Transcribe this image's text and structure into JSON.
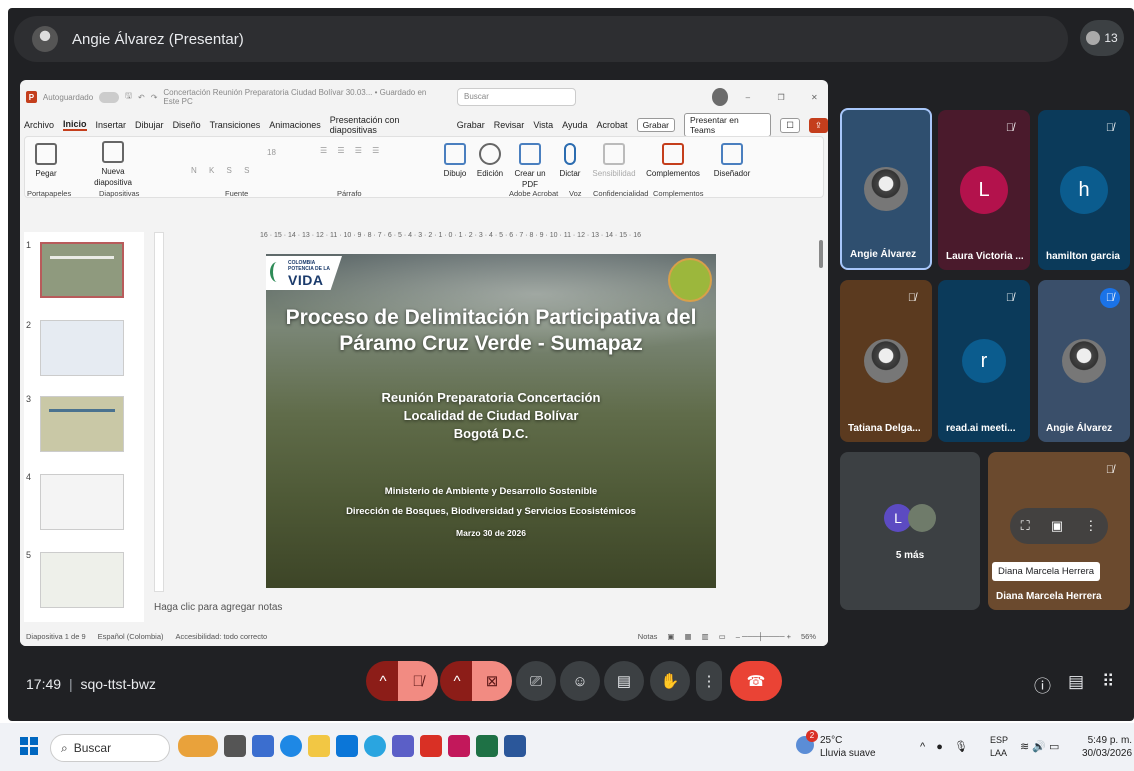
{
  "meet": {
    "presenter_label": "Angie Álvarez (Presentar)",
    "participant_count": "13",
    "time": "17:49",
    "separator": "|",
    "meeting_code": "sqo-ttst-bwz"
  },
  "ppt": {
    "autosave": "Autoguardado",
    "filename": "Concertación Reunión Preparatoria Ciudad Bolívar 30.03... • Guardado en Este PC",
    "search_placeholder": "Buscar",
    "menu": [
      "Archivo",
      "Inicio",
      "Insertar",
      "Dibujar",
      "Diseño",
      "Transiciones",
      "Animaciones",
      "Presentación con diapositivas",
      "Grabar",
      "Revisar",
      "Vista",
      "Ayuda",
      "Acrobat"
    ],
    "record_btn": "Grabar",
    "teams_btn": "Presentar en Teams",
    "ribbon": {
      "paste": "Pegar",
      "new_slide": "Nueva diapositiva",
      "draw": "Dibujo",
      "edit": "Edición",
      "create_pdf": "Crear un PDF",
      "dictate": "Dictar",
      "sensitivity": "Sensibilidad",
      "addins": "Complementos",
      "designer": "Diseñador",
      "font_size": "18",
      "groups": [
        "Portapapeles",
        "Diapositivas",
        "Fuente",
        "Párrafo",
        "Adobe Acrobat",
        "Voz",
        "Confidencialidad",
        "Complementos"
      ]
    },
    "ruler": "16 · 15 · 14 · 13 · 12 · 11 · 10 · 9 · 8 · 7 · 6 · 5 · 4 · 3 · 2 · 1 · 0 · 1 · 2 · 3 · 4 · 5 · 6 · 7 · 8 · 9 · 10 · 11 · 12 · 13 · 14 · 15 · 16",
    "thumb_numbers": [
      "1",
      "2",
      "3",
      "4",
      "5"
    ],
    "slide": {
      "logo_small": "COLOMBIA POTENCIA DE LA",
      "logo_big": "VIDA",
      "title_line1": "Proceso de Delimitación Participativa del",
      "title_line2": "Páramo Cruz Verde - Sumapaz",
      "sub1": "Reunión Preparatoria Concertación",
      "sub2": "Localidad de Ciudad Bolívar",
      "sub3": "Bogotá D.C.",
      "org1": "Ministerio de Ambiente y Desarrollo Sostenible",
      "org2": "Dirección de Bosques, Biodiversidad y Servicios Ecosistémicos",
      "date": "Marzo 30 de 2026"
    },
    "notes_placeholder": "Haga clic para agregar notas",
    "status": {
      "slide_of": "Diapositiva 1 de 9",
      "language": "Español (Colombia)",
      "accessibility": "Accesibilidad: todo correcto",
      "notes": "Notas",
      "zoom": "56%"
    }
  },
  "participants": [
    {
      "name": "Angie Álvarez",
      "initial": ""
    },
    {
      "name": "Laura Victoria ...",
      "initial": "L"
    },
    {
      "name": "hamilton garcia",
      "initial": "h"
    },
    {
      "name": "Tatiana Delga...",
      "initial": ""
    },
    {
      "name": "read.ai meeti...",
      "initial": "r"
    },
    {
      "name": "Angie Álvarez",
      "initial": ""
    }
  ],
  "more": {
    "label": "5 más",
    "initial": "L"
  },
  "diana": {
    "tooltip": "Diana Marcela Herrera",
    "name": "Diana Marcela Herrera"
  },
  "taskbar": {
    "search": "Buscar",
    "temp": "25°C",
    "weather": "Lluvia suave",
    "weather_badge": "2",
    "lang1": "ESP",
    "lang2": "LAA",
    "time": "5:49 p. m.",
    "date": "30/03/2026"
  },
  "colors": {
    "meet_bg": "#202124",
    "end_call": "#ea4335",
    "ppt_accent": "#c43e1c",
    "laura": "#b3124c",
    "blue_tile": "#0b3a5a"
  }
}
